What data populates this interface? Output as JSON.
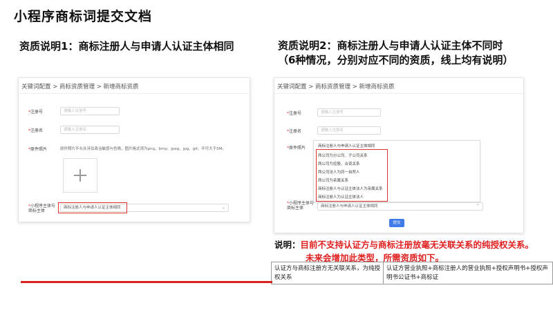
{
  "title": "小程序商标词提交文档",
  "left": {
    "heading": "资质说明1：商标注册人与申请人认证主体相同",
    "breadcrumb": "关键词配置 > 商标资质管理 > 新增商标资质",
    "fields": {
      "reg_no_label": "注册号",
      "reg_no_placeholder": "请输入注册号",
      "reg_name_label": "注册名",
      "reg_name_placeholder": "请输入注册名",
      "photo_label": "原件照片",
      "photo_hint": "原件照片不允许涉及政治敏感与色情，图片格式须为png、bmp、jpeg、jpg、gif，不可大于5M。",
      "relation_label_line1": "小程序主体与",
      "relation_label_line2": "商标主体",
      "relation_value": "商标注册人与申请人认证主体相同"
    }
  },
  "right": {
    "heading_line1": "资质说明2：商标注册人与申请人认证主体不同时",
    "heading_line2": "（6种情况，分别对应不同的资质，线上均有说明）",
    "breadcrumb": "关键词配置 > 商标资质管理 > 新增商标资质",
    "fields": {
      "reg_no_label": "注册号",
      "reg_no_placeholder": "请输入注册号",
      "reg_name_label": "注册名",
      "reg_name_placeholder": "请输入注册名",
      "photo_label": "原件照片",
      "relation_label_line1": "小程序主体与",
      "relation_label_line2": "商标主体",
      "relation_value": "商标注册人与申请人认证主体相同"
    },
    "dropdown": {
      "first": "商标注册人与申请人认证主体相同",
      "options": [
        "两公司为分公司、子公司关系",
        "两公司为控股、合资关系",
        "两公司法人为同一自然人",
        "两公司为亲属关系",
        "商标注册人与认证主体法人为亲属关系",
        "商标注册人为认证主体法人"
      ]
    },
    "submit": "提交"
  },
  "note": {
    "label": "说明：",
    "line1": "目前不支持认证方与商标注册放毫无关联关系的纯授权关系。",
    "line2": "未来会增加此类型，所需资质如下。"
  },
  "table": {
    "col1": "认证方与商标注册方无关联关系，为纯授权关系",
    "col2": "认证方营业执照+商标注册人的营业执照+授权声明书+授权声明书公证书+商标证"
  }
}
